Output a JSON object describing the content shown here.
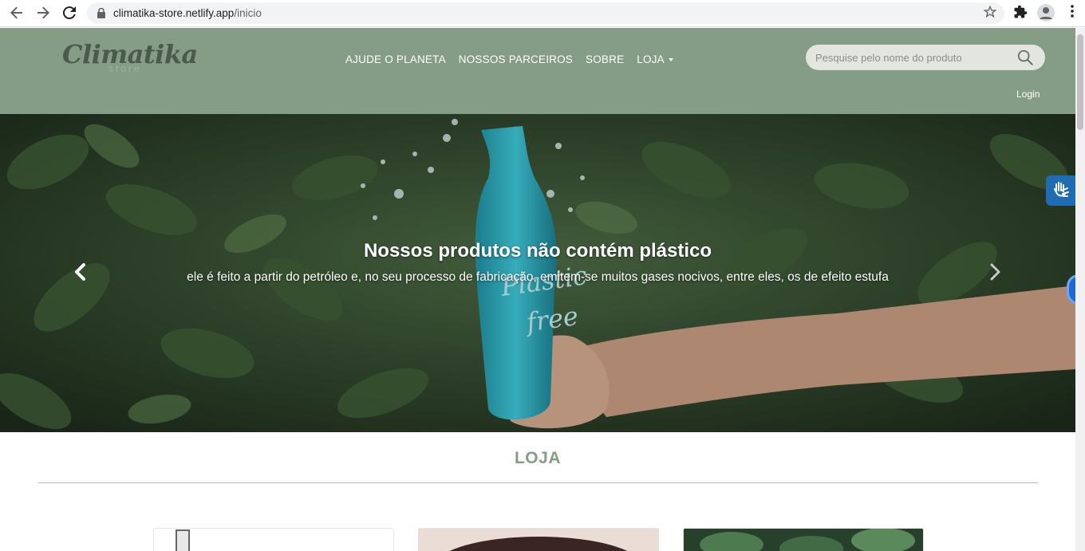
{
  "browser": {
    "url_host": "climatika-store.netlify.app",
    "url_path": "/inicio",
    "back_icon": "arrow-left-icon",
    "forward_icon": "arrow-right-icon",
    "reload_icon": "reload-icon",
    "lock_icon": "lock-icon",
    "star_icon": "star-icon",
    "extensions_icon": "puzzle-icon",
    "profile_icon": "profile-icon",
    "menu_icon": "kebab-menu-icon"
  },
  "header": {
    "logo_main": "Climatika",
    "logo_sub": "store",
    "nav": [
      {
        "label": "AJUDE O PLANETA"
      },
      {
        "label": "NOSSOS PARCEIROS"
      },
      {
        "label": "SOBRE"
      },
      {
        "label": "LOJA"
      }
    ],
    "search_placeholder": "Pesquise pelo nome do produto",
    "login_label": "Login",
    "colors": {
      "background": "#859d86",
      "text": "#ffffff"
    }
  },
  "hero": {
    "title": "Nossos produtos não contém plástico",
    "subtitle": "ele é feito a partir do petróleo e, no seu processo de fabricação, emitem-se muitos gases nocivos, entre eles, os de efeito estufa",
    "bottle_text_1": "Plastic",
    "bottle_text_2": "free",
    "prev_icon": "chevron-left-icon",
    "next_icon": "chevron-right-icon"
  },
  "store": {
    "title": "LOJA",
    "accent": "#859d86"
  },
  "widgets": {
    "vlibras_icon": "sign-language-hands-icon",
    "accessibility_icon": "accessibility-icon"
  }
}
